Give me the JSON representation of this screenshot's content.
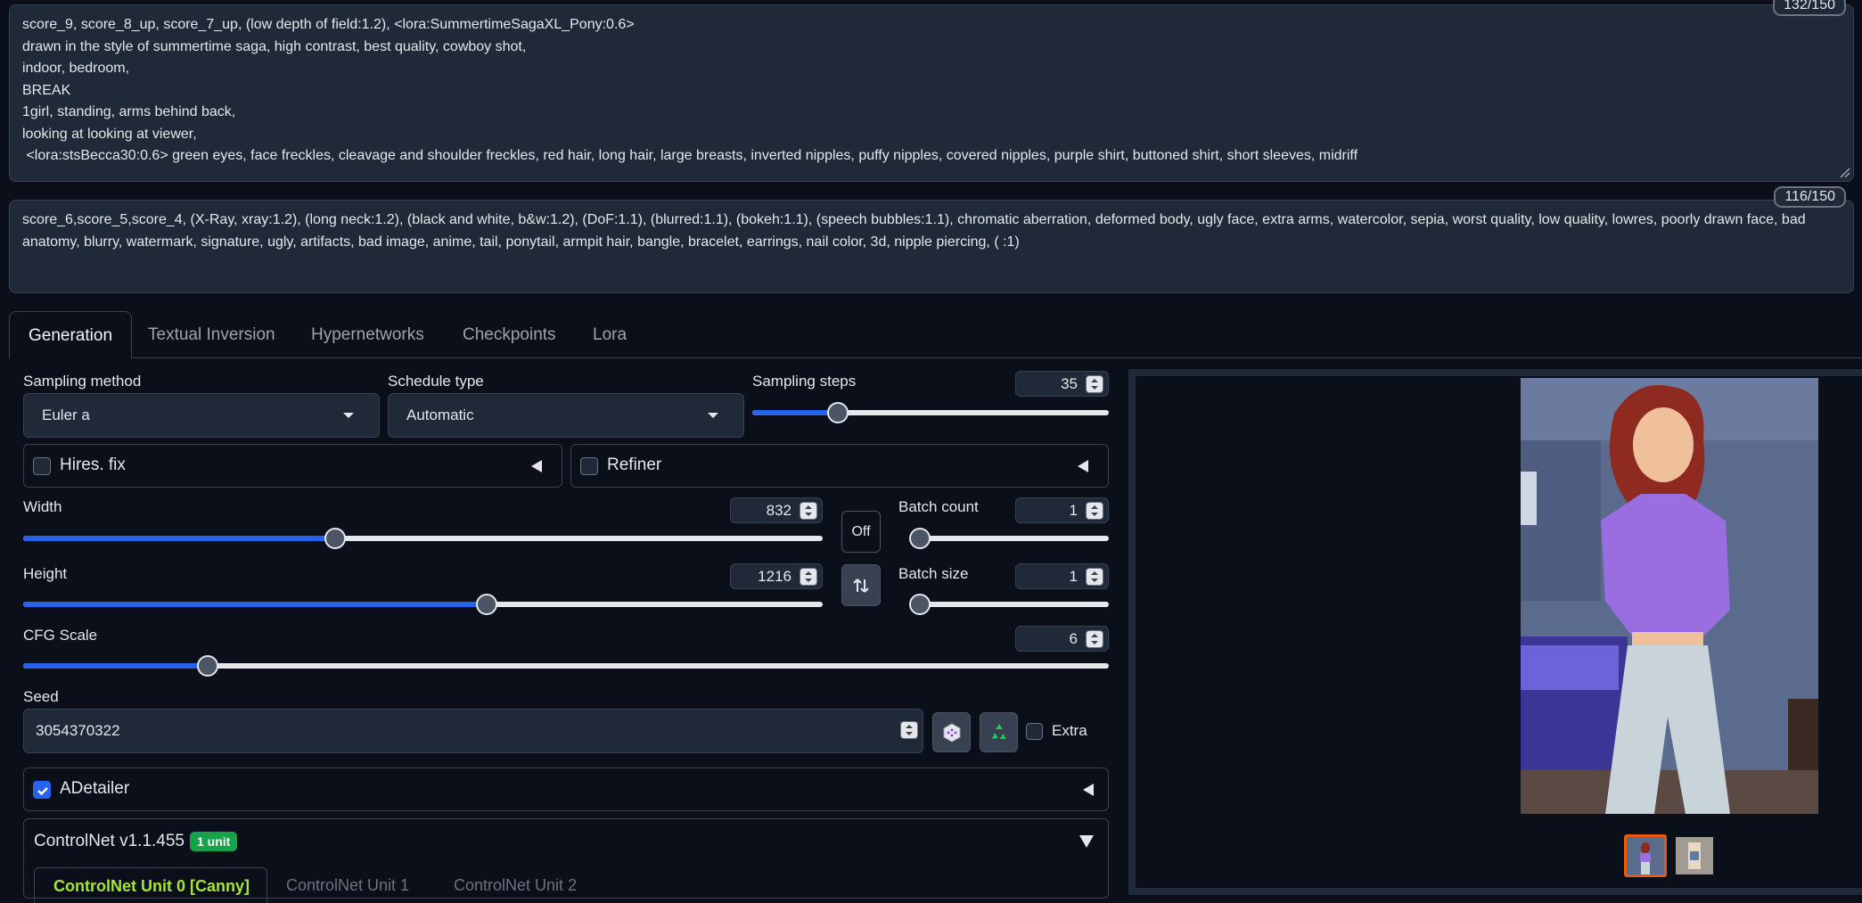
{
  "prompts": {
    "positive_text": "score_9, score_8_up, score_7_up, (low depth of field:1.2), <lora:SummertimeSagaXL_Pony:0.6>\ndrawn in the style of summertime saga, high contrast, best quality, cowboy shot,\nindoor, bedroom,\nBREAK\n1girl, standing, arms behind back,\nlooking at looking at viewer,\n <lora:stsBecca30:0.6> green eyes, face freckles, cleavage and shoulder freckles, red hair, long hair, large breasts, inverted nipples, puffy nipples, covered nipples, purple shirt, buttoned shirt, short sleeves, midriff",
    "positive_counter": "132/150",
    "negative_text": "score_6,score_5,score_4, (X-Ray, xray:1.2), (long neck:1.2), (black and white, b&w:1.2), (DoF:1.1), (blurred:1.1), (bokeh:1.1), (speech bubbles:1.1), chromatic aberration, deformed body, ugly face, extra arms, watercolor, sepia, worst quality, low quality, lowres, poorly drawn face, bad anatomy, blurry, watermark, signature, ugly, artifacts, bad image, anime, tail, ponytail, armpit hair, bangle, bracelet, earrings, nail color, 3d, nipple piercing, ( :1)",
    "negative_counter": "116/150"
  },
  "tabs": [
    "Generation",
    "Textual Inversion",
    "Hypernetworks",
    "Checkpoints",
    "Lora"
  ],
  "sampling": {
    "method_label": "Sampling method",
    "method_value": "Euler a",
    "schedule_label": "Schedule type",
    "schedule_value": "Automatic",
    "steps_label": "Sampling steps",
    "steps_value": "35",
    "steps_fraction": 0.24
  },
  "hires": {
    "label": "Hires. fix"
  },
  "refiner": {
    "label": "Refiner"
  },
  "dimensions": {
    "width_label": "Width",
    "width_value": "832",
    "width_fraction": 0.39,
    "height_label": "Height",
    "height_value": "1216",
    "height_fraction": 0.58,
    "off_label": "Off",
    "swap_icon": "swap-vertical-icon"
  },
  "batch": {
    "count_label": "Batch count",
    "count_value": "1",
    "count_fraction": 0.0,
    "size_label": "Batch size",
    "size_value": "1",
    "size_fraction": 0.0
  },
  "cfg": {
    "label": "CFG Scale",
    "value": "6",
    "fraction": 0.17
  },
  "seed": {
    "label": "Seed",
    "value": "3054370322",
    "dice_icon": "dice-icon",
    "recycle_icon": "recycle-icon",
    "extra_label": "Extra"
  },
  "adetailer": {
    "label": "ADetailer",
    "checked": true
  },
  "controlnet": {
    "label": "ControlNet v1.1.455",
    "badge": "1 unit",
    "units": [
      "ControlNet Unit 0 [Canny]",
      "ControlNet Unit 1",
      "ControlNet Unit 2"
    ]
  },
  "colors": {
    "accent": "#2563eb",
    "badge": "#16a34a",
    "thumb_selected": "#ea580c",
    "unit_active": "#a3e635"
  }
}
